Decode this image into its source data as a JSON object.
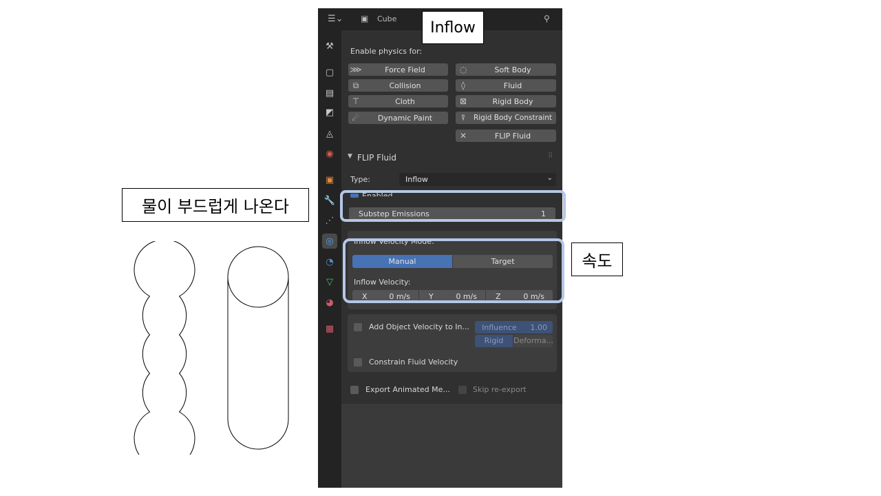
{
  "header": {
    "object_name": "Cube"
  },
  "physics": {
    "enable_label": "Enable physics for:",
    "buttons": [
      {
        "label": "Force Field",
        "icon": "force-field-icon"
      },
      {
        "label": "Soft Body",
        "icon": "soft-body-icon"
      },
      {
        "label": "Collision",
        "icon": "collision-icon"
      },
      {
        "label": "Fluid",
        "icon": "fluid-icon"
      },
      {
        "label": "Cloth",
        "icon": "cloth-icon"
      },
      {
        "label": "Rigid Body",
        "icon": "rigid-body-icon"
      },
      {
        "label": "Dynamic Paint",
        "icon": "dynamic-paint-icon"
      },
      {
        "label": "Rigid Body Constraint",
        "icon": "rigid-body-constraint-icon"
      },
      {
        "label": "FLIP Fluid",
        "icon": "close-icon"
      }
    ]
  },
  "flip": {
    "panel_title": "FLIP Fluid",
    "type_label": "Type:",
    "type_value": "Inflow",
    "enabled_label": "Enabled",
    "substep_label": "Substep Emissions",
    "substep_value": "1",
    "velocity_mode_label": "Inflow Velocity Mode:",
    "mode_manual": "Manual",
    "mode_target": "Target",
    "velocity_label": "Inflow Velocity:",
    "x_label": "X",
    "x_value": "0 m/s",
    "y_label": "Y",
    "y_value": "0 m/s",
    "z_label": "Z",
    "z_value": "0 m/s",
    "add_object_velocity": "Add Object Velocity to In...",
    "influence_label": "Influence",
    "influence_value": "1.00",
    "rigid": "Rigid",
    "deform": "Deforma...",
    "constrain": "Constrain Fluid Velocity",
    "export_animated": "Export Animated Me...",
    "skip_reexport": "Skip re-export"
  },
  "annotations": {
    "inflow": "Inflow",
    "smooth": "물이 부드럽게 나온다",
    "speed": "속도"
  },
  "colors": {
    "accent": "#4772b3",
    "highlight": "#b4c7e7",
    "panel_bg": "#303030"
  }
}
